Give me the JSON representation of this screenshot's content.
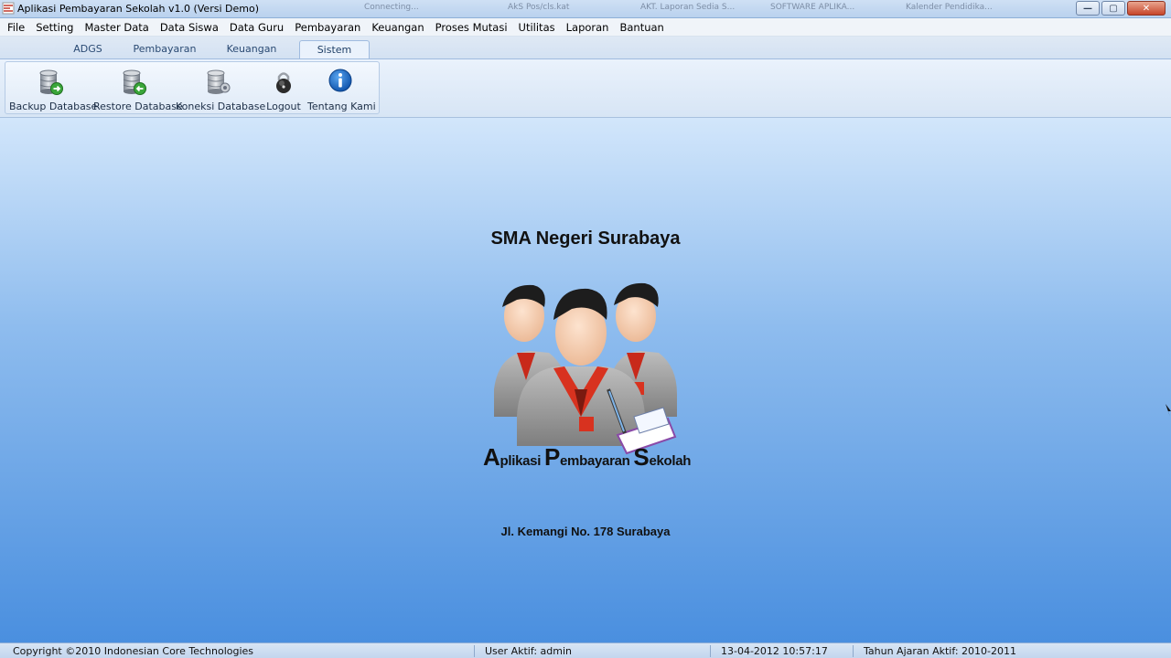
{
  "window": {
    "title": "Aplikasi Pembayaran Sekolah v1.0 (Versi Demo)",
    "background_tabs": [
      "Connecting...",
      "AkS Pos/cls.kat",
      "AKT. Laporan Sedia S...",
      "SOFTWARE APLIKA...",
      "Kalender Pendidika..."
    ],
    "controls": {
      "minimize": "—",
      "maximize": "▢",
      "close": "✕"
    }
  },
  "menu": [
    "File",
    "Setting",
    "Master Data",
    "Data Siswa",
    "Data Guru",
    "Pembayaran",
    "Keuangan",
    "Proses Mutasi",
    "Utilitas",
    "Laporan",
    "Bantuan"
  ],
  "ribbon": {
    "tabs": [
      "ADGS",
      "Pembayaran",
      "Keuangan",
      "Sistem"
    ],
    "active_tab": "Sistem",
    "buttons": [
      {
        "label": "Backup Database",
        "icon": "database-backup-icon"
      },
      {
        "label": "Restore Database",
        "icon": "database-restore-icon"
      },
      {
        "label": "Koneksi Database",
        "icon": "database-connection-icon"
      },
      {
        "label": "Logout",
        "icon": "padlock-icon"
      },
      {
        "label": "Tentang Kami",
        "icon": "info-icon"
      }
    ]
  },
  "main": {
    "school_name": "SMA Negeri Surabaya",
    "logo_text": {
      "w1_cap": "A",
      "w1_rest": "plikasi ",
      "w2_cap": "P",
      "w2_rest": "embayaran ",
      "w3_cap": "S",
      "w3_rest": "ekolah"
    },
    "address": "Jl. Kemangi No. 178 Surabaya"
  },
  "status": {
    "copyright": "Copyright ©2010 Indonesian Core Technologies",
    "user": "User Aktif: admin",
    "datetime": "13-04-2012 10:57:17",
    "academic_year": "Tahun Ajaran Aktif: 2010-2011"
  },
  "colors": {
    "accent": "#4a8fdf",
    "ribbon_bg": "#dfeaf7",
    "uniform_red": "#d8321f",
    "uniform_grey": "#8a8a8a"
  }
}
